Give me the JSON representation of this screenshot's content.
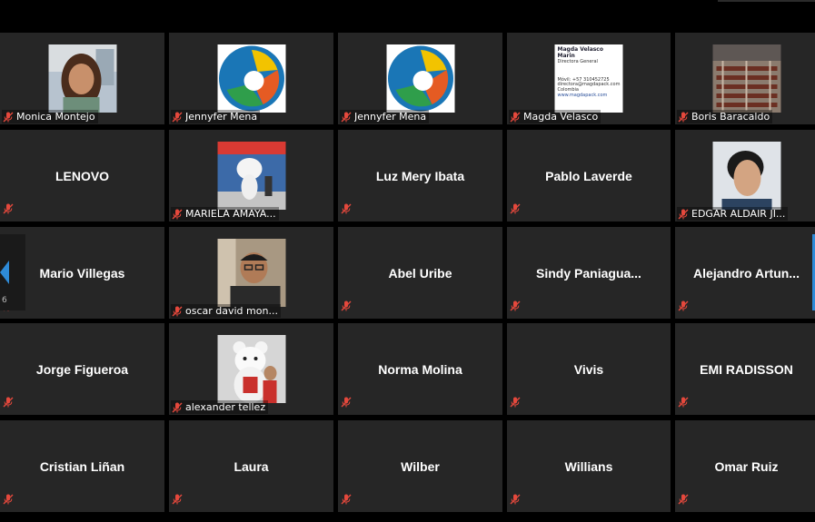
{
  "colors": {
    "tile_bg": "#262626",
    "gap": "#000000",
    "mute_red": "#e5483c",
    "scroll_accent": "#2e8bd8"
  },
  "page_indicator": "6",
  "participants": [
    {
      "name": "Monica Montejo",
      "display": "image",
      "picture": "woman-portrait",
      "muted": true
    },
    {
      "name": "Jennyfer Mena",
      "display": "image",
      "picture": "circular-logo",
      "muted": true
    },
    {
      "name": "Jennyfer Mena",
      "display": "image",
      "picture": "circular-logo",
      "muted": true
    },
    {
      "name": "Magda Velasco",
      "display": "image",
      "picture": "business-card",
      "muted": true,
      "card": {
        "line1": "Magda Velasco Marin",
        "line2": "Directora General",
        "line3": "Móvil: +57 310452725",
        "line4": "directora@magdapack.com",
        "line5": "Colombia",
        "line6": "www.magdapack.com"
      }
    },
    {
      "name": "Boris Baracaldo",
      "display": "image",
      "picture": "warehouse-photo",
      "muted": true
    },
    {
      "name": "LENOVO",
      "display": "name",
      "muted": true
    },
    {
      "name": "MARIELA AMAYA...",
      "display": "image",
      "picture": "mascot-store",
      "muted": true
    },
    {
      "name": "Luz Mery Ibata",
      "display": "name",
      "muted": true
    },
    {
      "name": "Pablo Laverde",
      "display": "name",
      "muted": true
    },
    {
      "name": "EDGAR ALDAIR JI...",
      "display": "image",
      "picture": "man-smiling",
      "muted": true
    },
    {
      "name": "Mario Villegas",
      "display": "name",
      "muted": true
    },
    {
      "name": "oscar david mon...",
      "display": "image",
      "picture": "man-glasses",
      "muted": true
    },
    {
      "name": "Abel Uribe",
      "display": "name",
      "muted": true
    },
    {
      "name": "Sindy  Paniagua...",
      "display": "name",
      "muted": true
    },
    {
      "name": "Alejandro  Artun...",
      "display": "name",
      "muted": true
    },
    {
      "name": "Jorge Figueroa",
      "display": "name",
      "muted": true
    },
    {
      "name": "alexander tellez",
      "display": "image",
      "picture": "bear-mascot",
      "muted": true
    },
    {
      "name": "Norma Molina",
      "display": "name",
      "muted": true
    },
    {
      "name": "Vivis",
      "display": "name",
      "muted": true
    },
    {
      "name": "EMI RADISSON",
      "display": "name",
      "muted": true
    },
    {
      "name": "Cristian Liñan",
      "display": "name",
      "muted": true
    },
    {
      "name": "Laura",
      "display": "name",
      "muted": true
    },
    {
      "name": "Wilber",
      "display": "name",
      "muted": true
    },
    {
      "name": "Willians",
      "display": "name",
      "muted": true
    },
    {
      "name": "Omar Ruiz",
      "display": "name",
      "muted": true
    }
  ]
}
